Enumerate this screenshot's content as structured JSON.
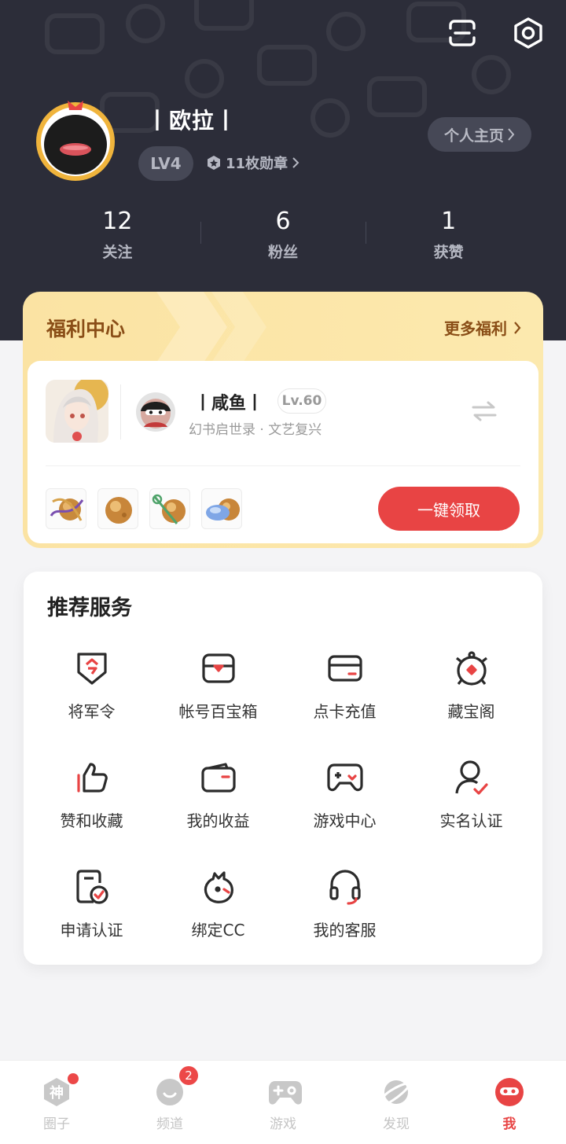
{
  "profile": {
    "username": "丨欧拉丨",
    "level": "LV4",
    "medals": "11枚勋章",
    "homepage_label": "个人主页"
  },
  "stats": [
    {
      "value": "12",
      "label": "关注"
    },
    {
      "value": "6",
      "label": "粉丝"
    },
    {
      "value": "1",
      "label": "获赞"
    }
  ],
  "welfare": {
    "title": "福利中心",
    "more": "更多福利",
    "role_name": "丨咸鱼丨",
    "role_level": "Lv.60",
    "role_server": "幻书启世录 · 文艺复兴",
    "claim_button": "一键领取"
  },
  "services": {
    "title": "推荐服务",
    "items": [
      {
        "label": "将军令",
        "icon": "general-token-icon"
      },
      {
        "label": "帐号百宝箱",
        "icon": "treasure-box-icon"
      },
      {
        "label": "点卡充值",
        "icon": "card-recharge-icon"
      },
      {
        "label": "藏宝阁",
        "icon": "treasure-pavilion-icon"
      },
      {
        "label": "赞和收藏",
        "icon": "thumbs-up-icon"
      },
      {
        "label": "我的收益",
        "icon": "wallet-icon"
      },
      {
        "label": "游戏中心",
        "icon": "gamepad-icon"
      },
      {
        "label": "实名认证",
        "icon": "user-verify-icon"
      },
      {
        "label": "申请认证",
        "icon": "apply-cert-icon"
      },
      {
        "label": "绑定CC",
        "icon": "bind-cc-icon"
      },
      {
        "label": "我的客服",
        "icon": "headset-icon"
      }
    ]
  },
  "tabbar": [
    {
      "label": "圈子",
      "icon": "circle-icon",
      "badge": "dot"
    },
    {
      "label": "频道",
      "icon": "channel-icon",
      "badge": "2"
    },
    {
      "label": "游戏",
      "icon": "gamepad-icon",
      "badge": ""
    },
    {
      "label": "发现",
      "icon": "planet-icon",
      "badge": ""
    },
    {
      "label": "我",
      "icon": "me-icon",
      "badge": ""
    }
  ],
  "colors": {
    "header_bg": "#2c2d39",
    "accent_red": "#e84444",
    "welfare_gold": "#fbe3a3",
    "welfare_text": "#8a4e17"
  }
}
